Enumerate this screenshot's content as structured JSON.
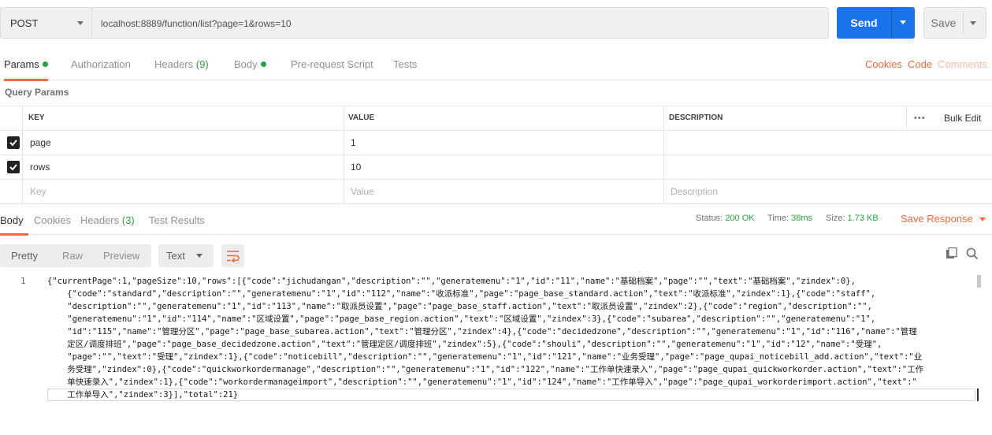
{
  "request": {
    "method": "POST",
    "url": "localhost:8889/function/list?page=1&rows=10",
    "send_label": "Send",
    "save_label": "Save"
  },
  "req_tabs": {
    "params": "Params",
    "authorization": "Authorization",
    "headers": "Headers",
    "headers_count": "(9)",
    "body": "Body",
    "prerequest": "Pre-request Script",
    "tests": "Tests",
    "cookies": "Cookies",
    "code": "Code",
    "comments": "Comments"
  },
  "query_params": {
    "title": "Query Params",
    "columns": {
      "key": "KEY",
      "value": "VALUE",
      "description": "DESCRIPTION"
    },
    "more": "•••",
    "bulk_edit": "Bulk Edit",
    "rows": [
      {
        "checked": true,
        "key": "page",
        "value": "1",
        "description": ""
      },
      {
        "checked": true,
        "key": "rows",
        "value": "10",
        "description": ""
      }
    ],
    "placeholder": {
      "key": "Key",
      "value": "Value",
      "description": "Description"
    }
  },
  "response": {
    "tabs": {
      "body": "Body",
      "cookies": "Cookies",
      "headers": "Headers",
      "headers_count": "(3)",
      "test_results": "Test Results"
    },
    "status_label": "Status:",
    "status_value": "200 OK",
    "time_label": "Time:",
    "time_value": "38ms",
    "size_label": "Size:",
    "size_value": "1.73 KB",
    "save_response": "Save Response"
  },
  "body_toolbar": {
    "pretty": "Pretty",
    "raw": "Raw",
    "preview": "Preview",
    "format": "Text"
  },
  "code": {
    "line_number": "1",
    "lines": [
      "{\"currentPage\":1,\"pageSize\":10,\"rows\":[{\"code\":\"jichudangan\",\"description\":\"\",\"generatemenu\":\"1\",\"id\":\"11\",\"name\":\"基础档案\",\"page\":\"\",\"text\":\"基础档案\",\"zindex\":0},",
      "    {\"code\":\"standard\",\"description\":\"\",\"generatemenu\":\"1\",\"id\":\"112\",\"name\":\"收派标准\",\"page\":\"page_base_standard.action\",\"text\":\"收派标准\",\"zindex\":1},{\"code\":\"staff\",",
      "    \"description\":\"\",\"generatemenu\":\"1\",\"id\":\"113\",\"name\":\"取派员设置\",\"page\":\"page_base_staff.action\",\"text\":\"取派员设置\",\"zindex\":2},{\"code\":\"region\",\"description\":\"\",",
      "    \"generatemenu\":\"1\",\"id\":\"114\",\"name\":\"区域设置\",\"page\":\"page_base_region.action\",\"text\":\"区域设置\",\"zindex\":3},{\"code\":\"subarea\",\"description\":\"\",\"generatemenu\":\"1\",",
      "    \"id\":\"115\",\"name\":\"管理分区\",\"page\":\"page_base_subarea.action\",\"text\":\"管理分区\",\"zindex\":4},{\"code\":\"decidedzone\",\"description\":\"\",\"generatemenu\":\"1\",\"id\":\"116\",\"name\":\"管理",
      "    定区/调度排班\",\"page\":\"page_base_decidedzone.action\",\"text\":\"管理定区/调度排班\",\"zindex\":5},{\"code\":\"shouli\",\"description\":\"\",\"generatemenu\":\"1\",\"id\":\"12\",\"name\":\"受理\",",
      "    \"page\":\"\",\"text\":\"受理\",\"zindex\":1},{\"code\":\"noticebill\",\"description\":\"\",\"generatemenu\":\"1\",\"id\":\"121\",\"name\":\"业务受理\",\"page\":\"page_qupai_noticebill_add.action\",\"text\":\"业",
      "    务受理\",\"zindex\":0},{\"code\":\"quickworkordermanage\",\"description\":\"\",\"generatemenu\":\"1\",\"id\":\"122\",\"name\":\"工作单快速录入\",\"page\":\"page_qupai_quickworkorder.action\",\"text\":\"工作",
      "    单快速录入\",\"zindex\":1},{\"code\":\"workordermanageimport\",\"description\":\"\",\"generatemenu\":\"1\",\"id\":\"124\",\"name\":\"工作单导入\",\"page\":\"page_qupai_workorderimport.action\",\"text\":\"",
      "    工作单导入\",\"zindex\":3}],\"total\":21}"
    ]
  }
}
